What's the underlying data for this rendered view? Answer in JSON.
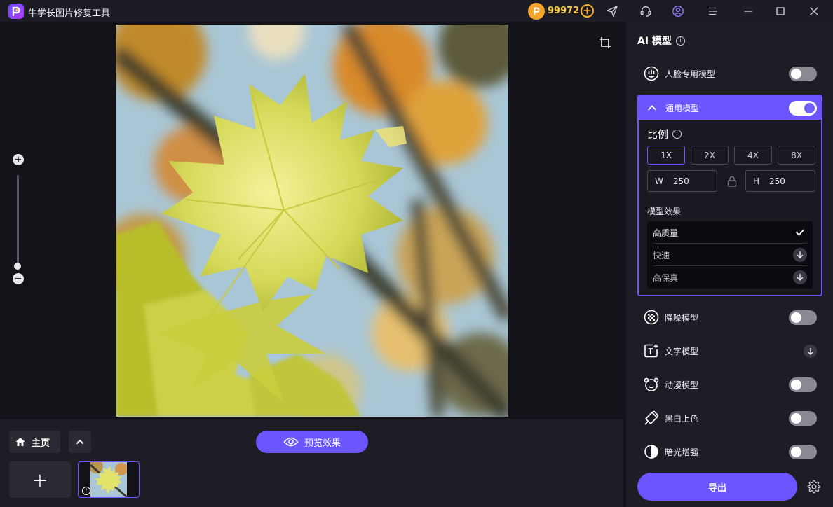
{
  "window": {
    "title": "牛学长图片修复工具",
    "coins": "99972"
  },
  "canvas": {
    "home_label": "主页",
    "preview_label": "预览效果"
  },
  "panel": {
    "title": "AI 模型",
    "models": [
      {
        "label": "人脸专用模型",
        "enabled": false
      },
      {
        "label": "通用模型",
        "enabled": true
      },
      {
        "label": "降噪模型",
        "enabled": false
      },
      {
        "label": "文字模型",
        "state": "download"
      },
      {
        "label": "动漫模型",
        "enabled": false
      },
      {
        "label": "黑白上色",
        "enabled": false
      },
      {
        "label": "暗光增强",
        "enabled": false
      }
    ],
    "scale": {
      "title": "比例",
      "options": [
        "1X",
        "2X",
        "4X",
        "8X"
      ],
      "selected": "1X",
      "width_label": "W",
      "width": "250",
      "height_label": "H",
      "height": "250"
    },
    "effect": {
      "title": "模型效果",
      "options": [
        {
          "label": "高质量",
          "state": "selected"
        },
        {
          "label": "快速",
          "state": "download"
        },
        {
          "label": "高保真",
          "state": "download"
        }
      ]
    },
    "export_label": "导出"
  },
  "colors": {
    "accent": "#6a55ff",
    "coin": "#f4a62a",
    "background": "#141319",
    "panel": "#1e1d25"
  }
}
